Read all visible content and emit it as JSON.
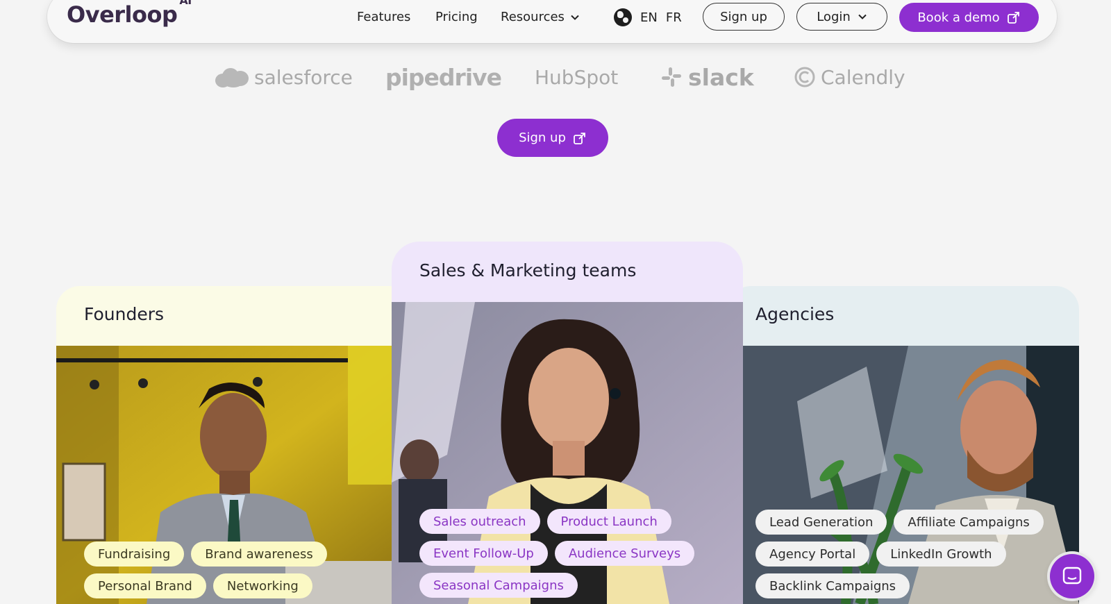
{
  "brand": {
    "name": "Overloop",
    "suffix": "AI"
  },
  "nav": {
    "features": "Features",
    "pricing": "Pricing",
    "resources": "Resources",
    "lang_en": "EN",
    "lang_fr": "FR",
    "signup": "Sign up",
    "login": "Login",
    "book_demo": "Book a demo"
  },
  "partners": [
    "salesforce",
    "pipedrive",
    "HubSpot",
    "slack",
    "Calendly"
  ],
  "cta": {
    "signup": "Sign up"
  },
  "cards": {
    "founders": {
      "title": "Founders",
      "tags": [
        "Fundraising",
        "Brand awareness",
        "Personal Brand",
        "Networking"
      ]
    },
    "sales": {
      "title": "Sales & Marketing teams",
      "tags": [
        "Sales outreach",
        "Product Launch",
        "Event Follow-Up",
        "Audience Surveys",
        "Seasonal Campaigns"
      ]
    },
    "agencies": {
      "title": "Agencies",
      "tags": [
        "Lead Generation",
        "Affiliate Campaigns",
        "Agency Portal",
        "LinkedIn Growth",
        "Backlink Campaigns"
      ]
    }
  },
  "colors": {
    "accent": "#8d2fd0",
    "founders_head": "#fbfbe6",
    "sales_head": "#efe6fb",
    "agencies_head": "#e5eef1"
  },
  "icons": [
    "globe-icon",
    "chevron-down-icon",
    "external-link-icon",
    "chat-icon"
  ]
}
